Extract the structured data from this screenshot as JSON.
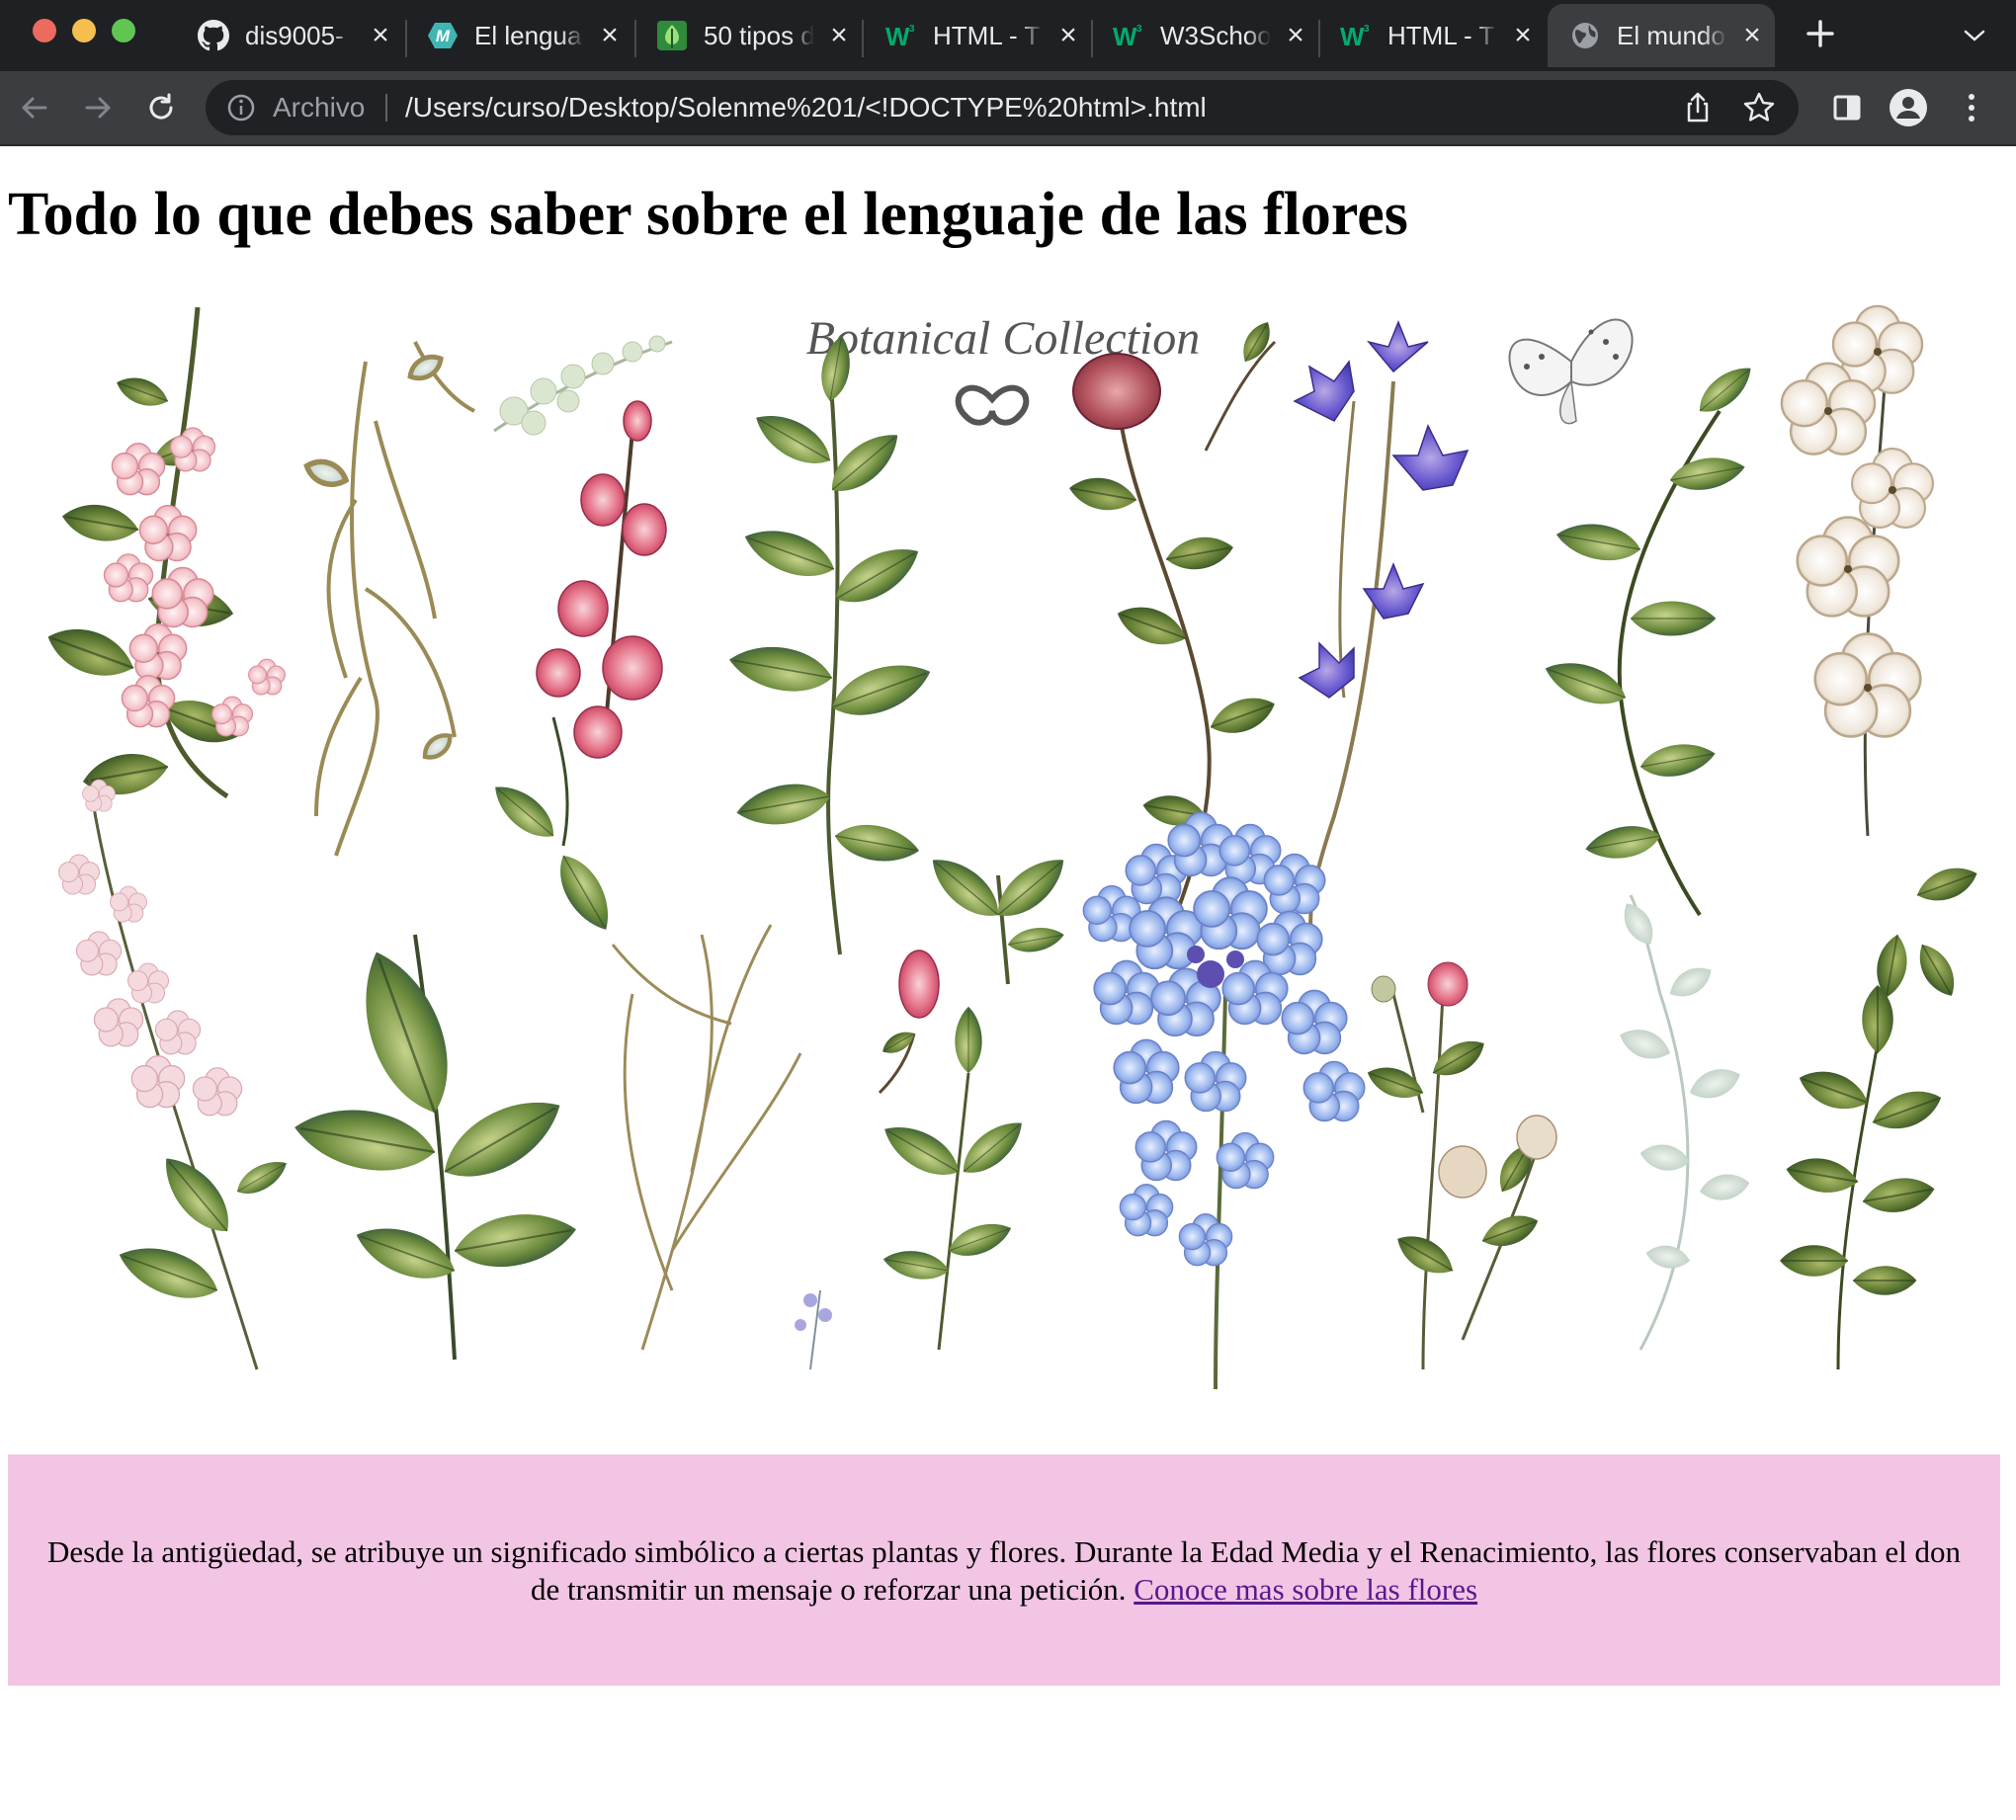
{
  "browser": {
    "tabs": [
      {
        "title": "dis9005-",
        "icon": "github-icon"
      },
      {
        "title": "El lengua",
        "icon": "site-m-icon"
      },
      {
        "title": "50 tipos d",
        "icon": "leaf-site-icon"
      },
      {
        "title": "HTML - T",
        "icon": "w3schools-icon"
      },
      {
        "title": "W3Schoo",
        "icon": "w3schools-icon"
      },
      {
        "title": "HTML - T",
        "icon": "w3schools-icon"
      },
      {
        "title": "El mundo",
        "icon": "globe-icon",
        "active": true
      }
    ],
    "address": {
      "scheme_label": "Archivo",
      "url": "/Users/curso/Desktop/Solenme%201/<!DOCTYPE%20html>.html"
    },
    "colors": {
      "tabbar": "#1f2023",
      "toolbar": "#3c3d40",
      "omnibox": "#202124"
    }
  },
  "page": {
    "title": "Todo lo que debes saber sobre el lenguaje de las flores",
    "image": {
      "caption_text": "Botanical Collection",
      "elements": [
        "pink-flower-sprig",
        "wild-grass",
        "eucalyptus",
        "pink-rosebuds",
        "green-foliage",
        "red-rose",
        "blue-bellflowers",
        "butterfly",
        "green-leaves",
        "cream-blossoms",
        "forget-me-nots",
        "peonies"
      ]
    },
    "info": {
      "text": "Desde la antigüedad, se atribuye un significado simbólico a ciertas plantas y flores. Durante la Edad Media y el Renacimiento, las flores conservaban el don de transmitir un mensaje o reforzar una petición.",
      "link": "Conoce mas sobre las flores",
      "background": "#f3c5e5"
    }
  }
}
